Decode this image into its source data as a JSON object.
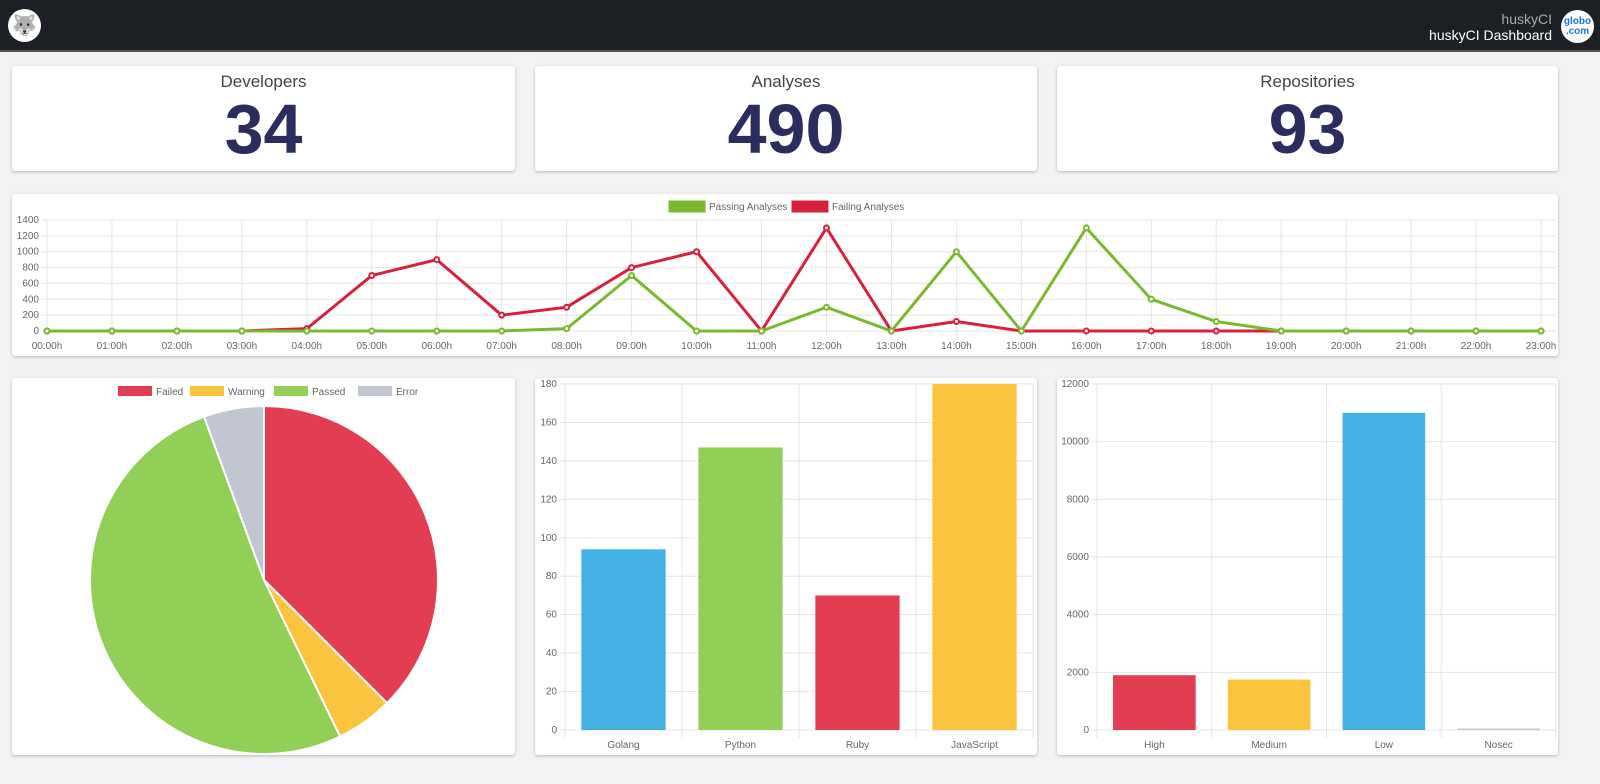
{
  "header": {
    "app": "huskyCI",
    "title": "huskyCI Dashboard",
    "logo_icon": "husky-logo-icon",
    "partner_logo": "globo.com",
    "partner_logo_lines": [
      "globo",
      ".com"
    ]
  },
  "stats": [
    {
      "label": "Developers",
      "value": "34"
    },
    {
      "label": "Analyses",
      "value": "490"
    },
    {
      "label": "Repositories",
      "value": "93"
    }
  ],
  "chart_data": [
    {
      "type": "line",
      "x": [
        "00:00h",
        "01:00h",
        "02:00h",
        "03:00h",
        "04:00h",
        "05:00h",
        "06:00h",
        "07:00h",
        "08:00h",
        "09:00h",
        "10:00h",
        "11:00h",
        "12:00h",
        "13:00h",
        "14:00h",
        "15:00h",
        "16:00h",
        "17:00h",
        "18:00h",
        "19:00h",
        "20:00h",
        "21:00h",
        "22:00h",
        "23:00h"
      ],
      "yticks": [
        0,
        200,
        400,
        600,
        800,
        1000,
        1200,
        1400
      ],
      "ylim": [
        0,
        1400
      ],
      "grid": true,
      "legend": "top",
      "series": [
        {
          "name": "Passing Analyses",
          "color": "#7cb82f",
          "values": [
            0,
            0,
            0,
            0,
            0,
            0,
            0,
            0,
            30,
            700,
            0,
            0,
            300,
            0,
            1000,
            0,
            1300,
            400,
            120,
            0,
            0,
            0,
            0,
            0
          ]
        },
        {
          "name": "Failing Analyses",
          "color": "#d7213c",
          "values": [
            0,
            0,
            0,
            0,
            30,
            700,
            900,
            200,
            300,
            800,
            1000,
            0,
            1300,
            0,
            120,
            0,
            0,
            0,
            0,
            0,
            0,
            0,
            0,
            0
          ]
        }
      ]
    },
    {
      "type": "pie",
      "legend": "top",
      "categories": [
        "Failed",
        "Warning",
        "Passed",
        "Error"
      ],
      "values": [
        37.5,
        5.3,
        51.6,
        5.6
      ],
      "colors": [
        "#e33d52",
        "#fbc43f",
        "#92cf57",
        "#c2c6d0"
      ]
    },
    {
      "type": "bar",
      "categories": [
        "Golang",
        "Python",
        "Ruby",
        "JavaScript"
      ],
      "values": [
        94,
        147,
        70,
        180
      ],
      "colors": [
        "#42b0e2",
        "#92cf57",
        "#e33d52",
        "#fbc43f"
      ],
      "ylim": [
        0,
        180
      ],
      "yticks": [
        0,
        20,
        40,
        60,
        80,
        100,
        120,
        140,
        160,
        180
      ],
      "grid": true
    },
    {
      "type": "bar",
      "categories": [
        "High",
        "Medium",
        "Low",
        "Nosec"
      ],
      "values": [
        1900,
        1750,
        11000,
        50
      ],
      "colors": [
        "#e33d52",
        "#fbc43f",
        "#42b0e2",
        "#c2c6d0"
      ],
      "ylim": [
        0,
        12000
      ],
      "yticks": [
        0,
        2000,
        4000,
        6000,
        8000,
        10000,
        12000
      ],
      "grid": true
    }
  ]
}
